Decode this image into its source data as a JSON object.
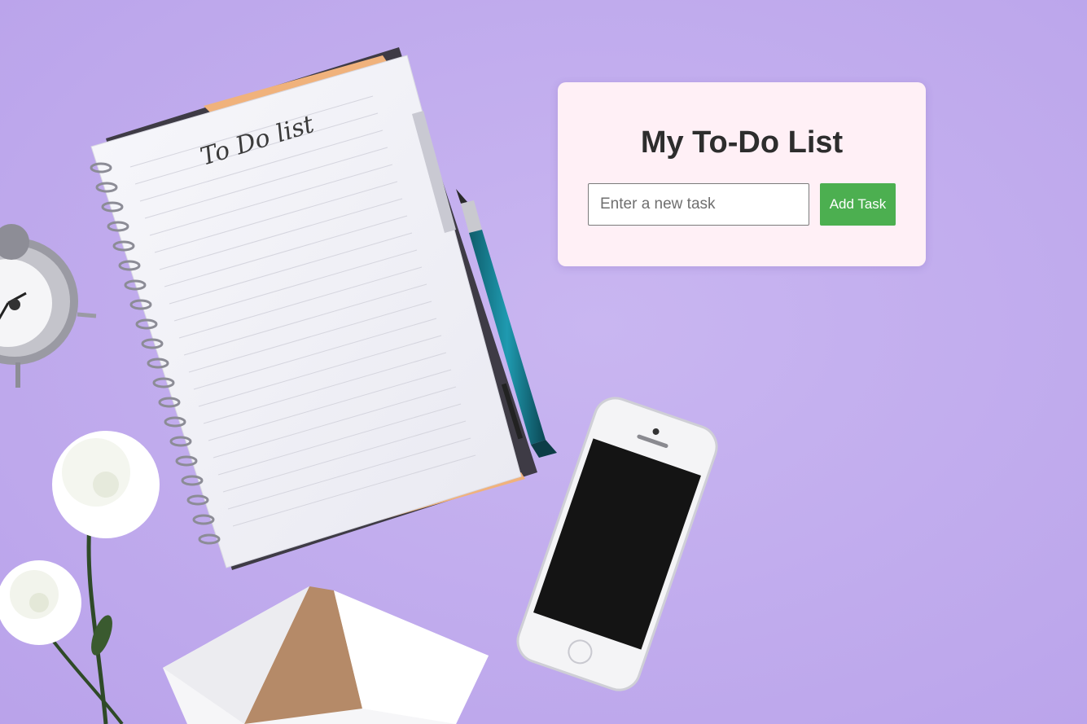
{
  "app": {
    "title": "My To-Do List"
  },
  "todo_form": {
    "input_value": "",
    "input_placeholder": "Enter a new task",
    "add_button_label": "Add Task"
  },
  "background": {
    "notebook_heading": "To Do list",
    "color": "#c4b0ef"
  },
  "colors": {
    "card_bg": "#fff0f6",
    "button_bg": "#4caf50",
    "button_text": "#ffffff",
    "title_text": "#2d2d2d"
  }
}
